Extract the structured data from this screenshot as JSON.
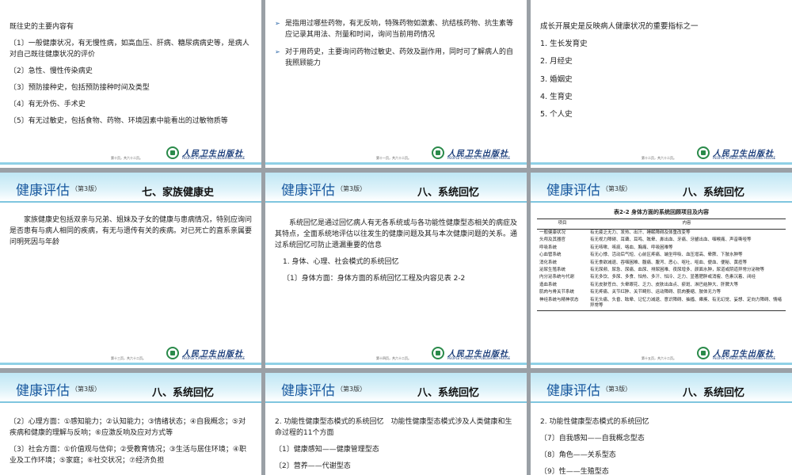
{
  "common": {
    "course_title": "健康评估",
    "edition": "（第3版）",
    "publisher_cn": "人民卫生出版社",
    "publisher_en": "PEOPLE'S MEDICAL PUBLISHING HOUSE",
    "brand_color": "#1a5aa0",
    "header_color": "#bfe6f4",
    "footer_color": "#8fd0e6"
  },
  "slides": [
    {
      "page": "第十页，共六十二页。",
      "lines": [
        "既往史的主要内容有",
        "〔1〕一般健康状况，有无慢性病，如高血压、肝病、糖尿病病史等，是病人对自己既往健康状况的评价",
        "〔2〕急性、慢性传染病史",
        "〔3〕预防接种史，包括预防接种时间及类型",
        "〔4〕有无外伤、手术史",
        "〔5〕有无过敏史，包括食物、药物、环境因素中能看出的过敏物质等"
      ]
    },
    {
      "page": "第十一页，共六十二页。",
      "lines": [
        "是指用过哪些药物，有无反响，特殊药物如激素、抗结核药物、抗生素等应记录其用法、剂量和时间，询问当前用药情况",
        "对于用药史，主要询问药物过敏史、药效及副作用，同时可了解病人的自我照顾能力"
      ]
    },
    {
      "page": "第十二页，共六十二页。",
      "lines": [
        "成长开展史是反映病人健康状况的重要指标之一",
        "1. 生长发育史",
        "2. 月经史",
        "3. 婚姻史",
        "4. 生育史",
        "5. 个人史"
      ]
    },
    {
      "section": "七、家族健康史",
      "page": "第十三页，共六十二页。",
      "lines": [
        "家族健康史包括双亲与兄弟、姐妹及子女的健康与患病情况，特别应询问是否患有与病人相同的疾病，有无与遗传有关的疾病。对已死亡的直系亲属要问明死因与年龄"
      ]
    },
    {
      "section": "八、系统回忆",
      "page": "第十四页，共六十二页。",
      "lines": [
        "系统回忆是通过回忆病人有无各系统或与各功能性健康型态相关的病症及其特点，全面系统地评估以往发生的健康问题及其与本次健康问题的关系。通过系统回忆可防止遗漏重要的信息",
        "1. 身体、心理、社会模式的系统回忆",
        "〔1〕身体方面：身体方面的系统回忆工程及内容见表 2-2"
      ]
    },
    {
      "section": "八、系统回忆",
      "page": "第十五页，共六十二页。",
      "table": {
        "caption": "表2-2 身体方面的系统回顾项目及内容",
        "headers": [
          "项目",
          "内容"
        ],
        "rows": [
          [
            "一般健康状况",
            "有无疲乏无力、发热、出汗、睡眠障碍及体重改变等"
          ],
          [
            "头颅及其器官",
            "有无视力障碍、耳聋、耳鸣、眩晕、鼻出血、牙痛、牙龈出血、咽喉痛、声音嘶哑等"
          ],
          [
            "呼吸系统",
            "有无咳嗽、咳痰、咯血、胸痛、呼吸困难等"
          ],
          [
            "心血管系统",
            "有无心悸、活动后气短、心前区疼痛、端坐呼吸、血压增高、晕厥、下肢水肿等"
          ],
          [
            "消化系统",
            "有无食欲减退、吞咽困难、腹痛、腹泻、恶心、呕吐、呕血、便血、便秘、黄疸等"
          ],
          [
            "泌尿生殖系统",
            "有无尿频、尿急、尿痛、血尿、排尿困难、夜尿增多、颜面水肿，尿道或阴道异常分泌物等"
          ],
          [
            "内分泌系统与代谢",
            "有无多饮、多尿、多食、怕热、多汗、怕冷、乏力、显著肥胖或消瘦、色素沉着、闭经"
          ],
          [
            "造血系统",
            "有无皮肤苍白、头晕眼花、乏力、皮肤出血点、瘀斑、淋巴结肿大、肝脾大等"
          ],
          [
            "肌肉与骨关节系统",
            "有无疼痛、关节红肿、关节畸形、运动障碍、肌肉萎缩、肢体无力等"
          ],
          [
            "神经系统与精神状态",
            "有无头痛、头昏、眩晕、记忆力减退、意识障碍、抽搐、瘫痪、有无幻觉、妄想、定向力障碍、情绪异常等"
          ]
        ]
      }
    },
    {
      "section": "八、系统回忆",
      "lines": [
        "〔2〕心理方面：①感知能力；②认知能力；③情绪状态；④自我概念；⑤对疾病和健康的理解与反响；⑥应激反响及应对方式等",
        "〔3〕社会方面：①价值观与信仰；②受教育情况；③生活与居住环境；④职业及工作环境；⑤家庭；⑥社交状况；⑦经济负担"
      ]
    },
    {
      "section": "八、系统回忆",
      "lines": [
        "2. 功能性健康型态模式的系统回忆　功能性健康型态模式涉及人类健康和生命过程的11个方面",
        "〔1〕健康感知——健康管理型态",
        "〔2〕营养——代谢型态"
      ]
    },
    {
      "section": "八、系统回忆",
      "lines": [
        "2. 功能性健康型态模式的系统回忆",
        "〔7〕自我感知——自我概念型态",
        "〔8〕角色——关系型态",
        "〔9〕性——生殖型态"
      ]
    }
  ]
}
